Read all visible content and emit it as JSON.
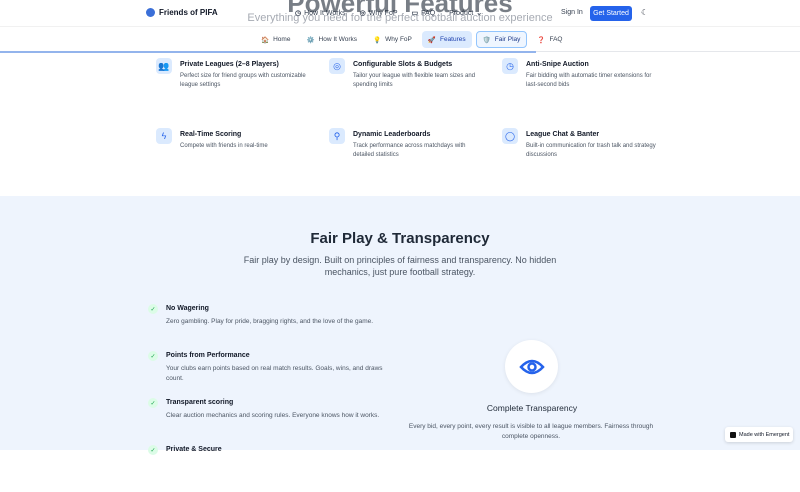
{
  "background": {
    "title": "Powerful Features",
    "subtitle": "Everything you need for the perfect football auction experience"
  },
  "header": {
    "brand": "Friends of PIFA",
    "nav": [
      "How It Works",
      "Why FoP",
      "FAQ",
      "Product"
    ],
    "sign_in": "Sign In",
    "get_started": "Get Started"
  },
  "subnav": [
    {
      "icon": "🏠",
      "label": "Home"
    },
    {
      "icon": "⚙️",
      "label": "How It Works"
    },
    {
      "icon": "💡",
      "label": "Why FoP"
    },
    {
      "icon": "🚀",
      "label": "Features"
    },
    {
      "icon": "🛡️",
      "label": "Fair Play"
    },
    {
      "icon": "❓",
      "label": "FAQ"
    }
  ],
  "scroll_progress_percent": 67,
  "features": [
    {
      "icon": "users-icon",
      "title": "Private Leagues (2–8 Players)",
      "desc": "Perfect size for friend groups with customizable league settings"
    },
    {
      "icon": "target-icon",
      "title": "Configurable Slots & Budgets",
      "desc": "Tailor your league with flexible team sizes and spending limits"
    },
    {
      "icon": "clock-icon",
      "title": "Anti-Snipe Auction",
      "desc": "Fair bidding with automatic timer extensions for last-second bids"
    },
    {
      "icon": "zap-icon",
      "title": "Real-Time Scoring",
      "desc": "Compete with friends in real-time"
    },
    {
      "icon": "award-icon",
      "title": "Dynamic Leaderboards",
      "desc": "Track performance across matchdays with detailed statistics"
    },
    {
      "icon": "chat-icon",
      "title": "League Chat & Banter",
      "desc": "Built-in communication for trash talk and strategy discussions"
    }
  ],
  "fair_play": {
    "title": "Fair Play & Transparency",
    "lead": "Fair play by design. Built on principles of fairness and transparency. No hidden mechanics, just pure football strategy.",
    "items": [
      {
        "title": "No Wagering",
        "desc": "Zero gambling. Play for pride, bragging rights, and the love of the game."
      },
      {
        "title": "Points from Performance",
        "desc": "Your clubs earn points based on real match results. Goals, wins, and draws count."
      },
      {
        "title": "Transparent scoring",
        "desc": "Clear auction mechanics and scoring rules. Everyone knows how it works."
      },
      {
        "title": "Private & Secure",
        "desc": ""
      }
    ],
    "card_title": "Complete Transparency",
    "card_desc": "Every bid, every point, every result is visible to all league members. Fairness through complete openness."
  },
  "badge": "Made with Emergent"
}
